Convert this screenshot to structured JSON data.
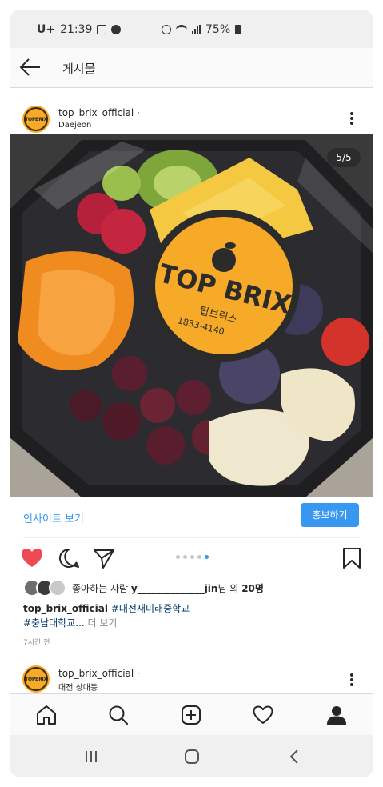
{
  "status_bar": {
    "carrier": "U+",
    "time": "21:39",
    "battery": "75%"
  },
  "header": {
    "title": "게시물"
  },
  "post": {
    "username": "top_brix_official",
    "username_suffix": " ·",
    "location": "Daejeon",
    "avatar_text": "TOPBRIX",
    "image_counter": "5/5",
    "photo_label": {
      "brand": "TOP BRIX",
      "korean": "탑브릭스",
      "phone": "1833-4140"
    },
    "insight_label": "인사이트 보기",
    "promote_label": "홍보하기",
    "carousel_count": 5,
    "carousel_active_index": 4,
    "likes_prefix": "좋아하는 사람 ",
    "likes_user": "y______________jin",
    "likes_mid": "님 외 ",
    "likes_count": "20명",
    "caption_user": "top_brix_official",
    "caption_tag1": "#대전새미래중학교",
    "caption_tag2": "#충남대학교",
    "caption_ellipsis": "... ",
    "caption_more": "더 보기",
    "time_ago": "7시간 전"
  },
  "next_post": {
    "username": "top_brix_official",
    "username_suffix": " ·",
    "location": "대전 상대동",
    "avatar_text": "TOPBRIX"
  },
  "colors": {
    "accent": "#3897f0",
    "heart": "#ed4956",
    "brand_orange": "#f7a928"
  }
}
